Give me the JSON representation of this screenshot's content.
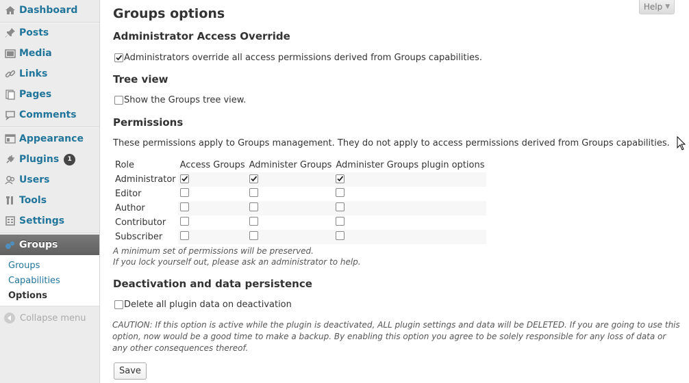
{
  "sidebar": {
    "items": [
      {
        "label": "Dashboard",
        "icon": "dashboard-icon"
      },
      {
        "label": "Posts",
        "icon": "pin-icon"
      },
      {
        "label": "Media",
        "icon": "media-icon"
      },
      {
        "label": "Links",
        "icon": "link-icon"
      },
      {
        "label": "Pages",
        "icon": "pages-icon"
      },
      {
        "label": "Comments",
        "icon": "comment-icon"
      },
      {
        "label": "Appearance",
        "icon": "appearance-icon"
      },
      {
        "label": "Plugins",
        "icon": "plugin-icon",
        "badge": "1"
      },
      {
        "label": "Users",
        "icon": "users-icon"
      },
      {
        "label": "Tools",
        "icon": "tools-icon"
      },
      {
        "label": "Settings",
        "icon": "settings-icon"
      },
      {
        "label": "Groups",
        "icon": "groups-icon"
      }
    ],
    "submenu": [
      {
        "label": "Groups"
      },
      {
        "label": "Capabilities"
      },
      {
        "label": "Options"
      }
    ],
    "collapse_label": "Collapse menu"
  },
  "help": {
    "label": "Help"
  },
  "page": {
    "title": "Groups options",
    "admin_override": {
      "heading": "Administrator Access Override",
      "checkbox_label": "Administrators override all access permissions derived from Groups capabilities.",
      "checked": true
    },
    "tree_view": {
      "heading": "Tree view",
      "checkbox_label": "Show the Groups tree view.",
      "checked": false
    },
    "permissions": {
      "heading": "Permissions",
      "description": "These permissions apply to Groups management. They do not apply to access permissions derived from Groups capabilities.",
      "columns": [
        "Role",
        "Access Groups",
        "Administer Groups",
        "Administer Groups plugin options"
      ],
      "rows": [
        {
          "role": "Administrator",
          "values": [
            true,
            true,
            true
          ]
        },
        {
          "role": "Editor",
          "values": [
            false,
            false,
            false
          ]
        },
        {
          "role": "Author",
          "values": [
            false,
            false,
            false
          ]
        },
        {
          "role": "Contributor",
          "values": [
            false,
            false,
            false
          ]
        },
        {
          "role": "Subscriber",
          "values": [
            false,
            false,
            false
          ]
        }
      ],
      "note1": "A minimum set of permissions will be preserved.",
      "note2": "If you lock yourself out, please ask an administrator to help."
    },
    "deactivation": {
      "heading": "Deactivation and data persistence",
      "checkbox_label": "Delete all plugin data on deactivation",
      "checked": false,
      "caution": "CAUTION: If this option is active while the plugin is deactivated, ALL plugin settings and data will be DELETED. If you are going to use this option, now would be a good time to make a backup. By enabling this option you agree to be solely responsible for any loss of data or any other consequences thereof."
    },
    "save_label": "Save"
  },
  "colors": {
    "link": "#21759b",
    "sidebar_bg": "#ececec",
    "current_menu_bg": "#6d6d6d"
  }
}
